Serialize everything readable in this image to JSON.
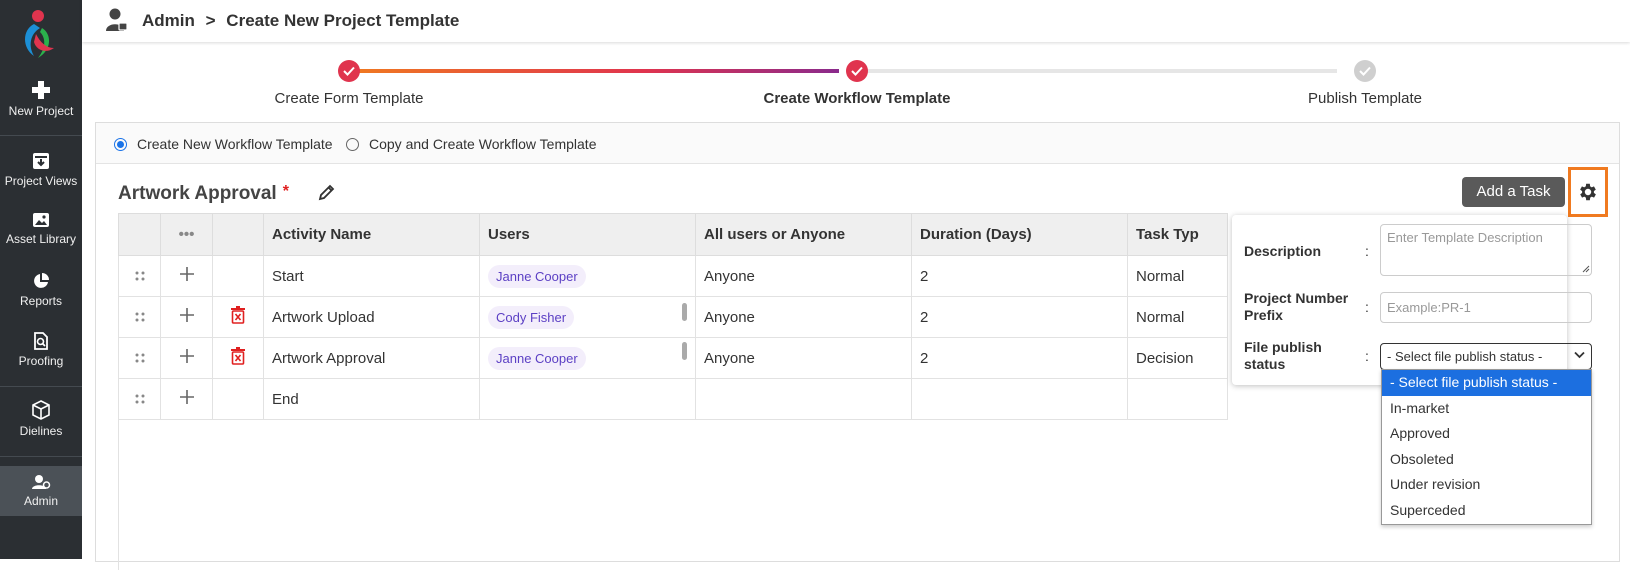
{
  "colors": {
    "sidebar_bg": "#2b2f33",
    "accent_orange": "#f07a20",
    "step_done": "#e0344e",
    "chip_text": "#5b3fc4",
    "delete_red": "#e02020",
    "selected_option": "#1c6fe0"
  },
  "sidebar": {
    "items": [
      {
        "label": "New Project",
        "icon": "plus-icon"
      },
      {
        "label": "Project Views",
        "icon": "archive-icon"
      },
      {
        "label": "Asset Library",
        "icon": "image-icon"
      },
      {
        "label": "Reports",
        "icon": "pie-chart-icon"
      },
      {
        "label": "Proofing",
        "icon": "proof-document-icon"
      },
      {
        "label": "Dielines",
        "icon": "cube-icon"
      },
      {
        "label": "Admin",
        "icon": "admin-user-icon"
      }
    ]
  },
  "header": {
    "crumb_root": "Admin",
    "separator": ">",
    "crumb_current": "Create New Project Template"
  },
  "stepper": {
    "steps": [
      {
        "label": "Create Form Template",
        "state": "done"
      },
      {
        "label": "Create Workflow Template",
        "state": "current"
      },
      {
        "label": "Publish Template",
        "state": "pending"
      }
    ]
  },
  "workflow_mode": {
    "options": [
      {
        "label": "Create New Workflow Template",
        "selected": true
      },
      {
        "label": "Copy and Create Workflow Template",
        "selected": false
      }
    ]
  },
  "template": {
    "title": "Artwork Approval",
    "required_mark": "*",
    "add_task_label": "Add a Task"
  },
  "table": {
    "more_header": "•••",
    "columns": [
      "Activity Name",
      "Users",
      "All users or Anyone",
      "Duration (Days)",
      "Task Typ"
    ],
    "rows": [
      {
        "activity": "Start",
        "user": "Janne Cooper",
        "scope": "Anyone",
        "duration": "2",
        "type": "Normal",
        "deletable": false
      },
      {
        "activity": "Artwork Upload",
        "user": "Cody Fisher",
        "scope": "Anyone",
        "duration": "2",
        "type": "Normal",
        "deletable": true
      },
      {
        "activity": "Artwork Approval",
        "user": "Janne Cooper",
        "scope": "Anyone",
        "duration": "2",
        "type": "Decision",
        "deletable": true
      },
      {
        "activity": "End",
        "user": "",
        "scope": "",
        "duration": "",
        "type": "",
        "deletable": false
      }
    ]
  },
  "settings_popover": {
    "description_label": "Description",
    "description_placeholder": "Enter Template Description",
    "prefix_label_line1": "Project Number",
    "prefix_label_line2": "Prefix",
    "prefix_placeholder": "Example:PR-1",
    "publish_label_line1": "File publish",
    "publish_label_line2": "status",
    "publish_selected": "- Select file publish status -",
    "colon": ":"
  },
  "publish_status_options": [
    "- Select file publish status -",
    "In-market",
    "Approved",
    "Obsoleted",
    "Under revision",
    "Superceded"
  ]
}
